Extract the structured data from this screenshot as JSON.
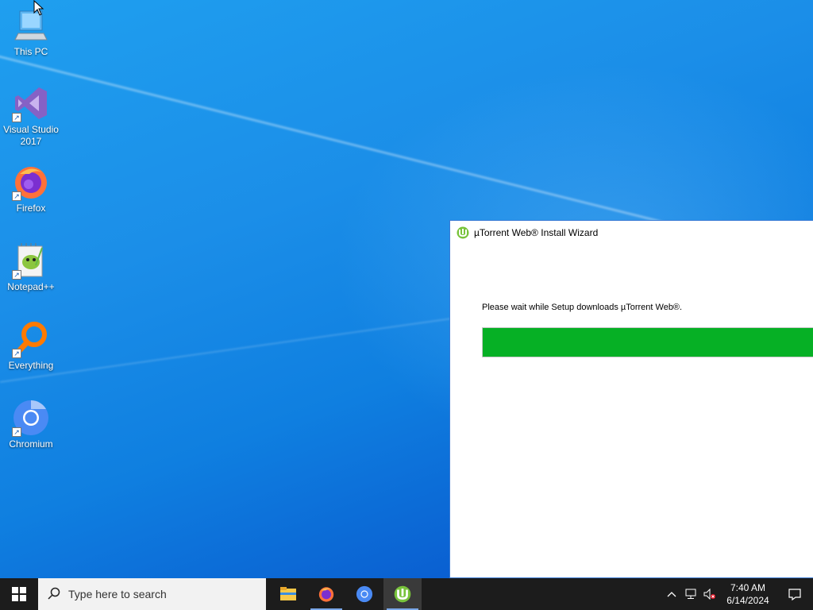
{
  "desktop": {
    "icons": [
      {
        "label": "This PC",
        "icon": "computer-icon"
      },
      {
        "label": "Visual Studio 2017",
        "icon": "visual-studio-icon"
      },
      {
        "label": "Firefox",
        "icon": "firefox-icon"
      },
      {
        "label": "Notepad++",
        "icon": "notepadpp-icon"
      },
      {
        "label": "Everything",
        "icon": "everything-search-icon"
      },
      {
        "label": "Chromium",
        "icon": "chromium-icon"
      }
    ]
  },
  "wizard": {
    "title": "µTorrent Web® Install Wizard",
    "message": "Please wait while Setup downloads µTorrent Web®.",
    "progress_fraction": 1.0,
    "progress_color": "#06b025"
  },
  "taskbar": {
    "search_placeholder": "Type here to search",
    "apps": [
      "file-explorer-icon",
      "firefox-icon",
      "chromium-icon",
      "utorrent-icon"
    ],
    "clock_time": "7:40 AM",
    "clock_date": "6/14/2024"
  }
}
